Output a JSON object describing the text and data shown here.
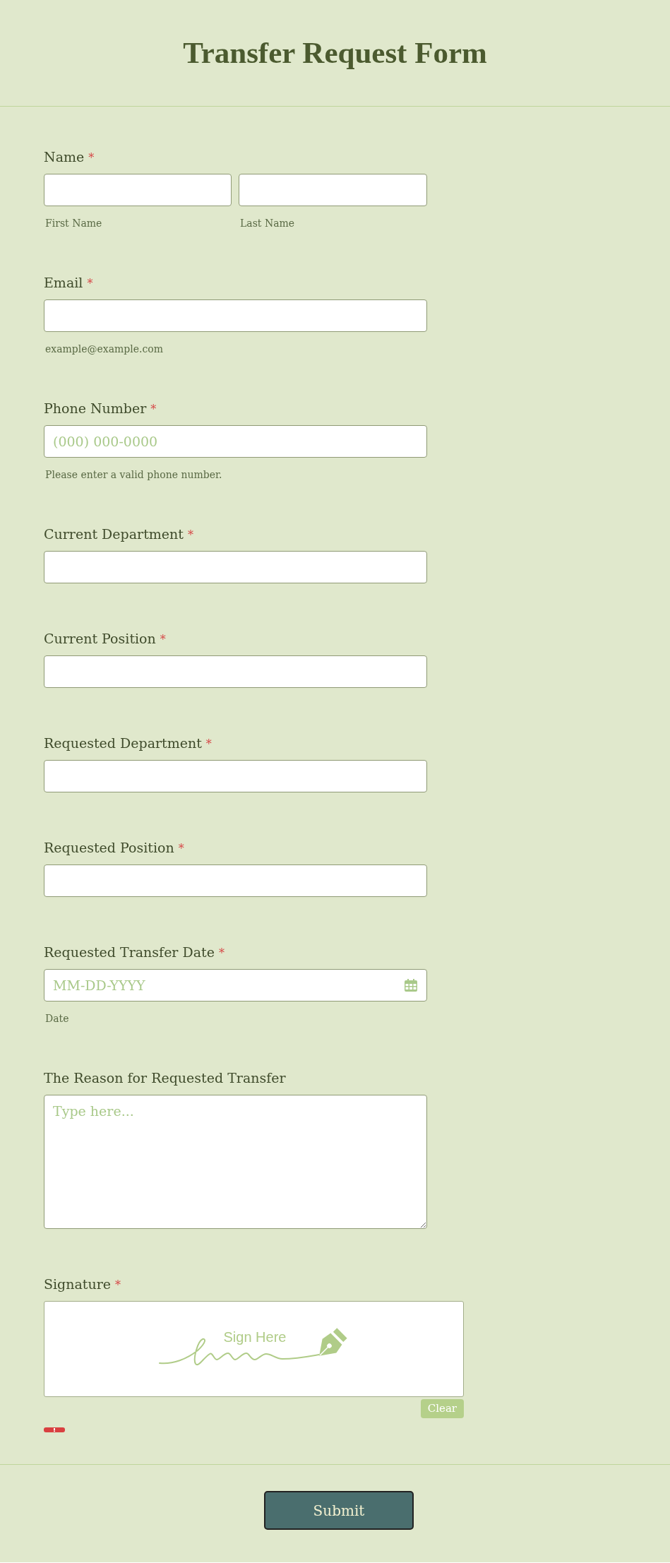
{
  "header": {
    "title": "Transfer Request Form"
  },
  "required_mark": "*",
  "fields": [
    {
      "kind": "name",
      "label": "Name",
      "required": true,
      "inputs": [
        {
          "sublabel": "First Name"
        },
        {
          "sublabel": "Last Name"
        }
      ]
    },
    {
      "kind": "text",
      "label": "Email",
      "required": true,
      "sublabel": "example@example.com"
    },
    {
      "kind": "text",
      "label": "Phone Number",
      "required": true,
      "placeholder": "(000) 000-0000",
      "sublabel": "Please enter a valid phone number."
    },
    {
      "kind": "text",
      "label": "Current Department",
      "required": true
    },
    {
      "kind": "text",
      "label": "Current Position",
      "required": true
    },
    {
      "kind": "text",
      "label": "Requested Department",
      "required": true
    },
    {
      "kind": "text",
      "label": "Requested Position",
      "required": true
    },
    {
      "kind": "date",
      "label": "Requested Transfer Date",
      "required": true,
      "placeholder": "MM-DD-YYYY",
      "sublabel": "Date"
    },
    {
      "kind": "textarea",
      "label": "The Reason for Requested Transfer",
      "required": false,
      "placeholder": "Type here..."
    },
    {
      "kind": "signature",
      "label": "Signature",
      "required": true,
      "pad_text": "Sign Here",
      "clear_label": "Clear",
      "error": true
    }
  ],
  "submit": {
    "label": "Submit"
  }
}
